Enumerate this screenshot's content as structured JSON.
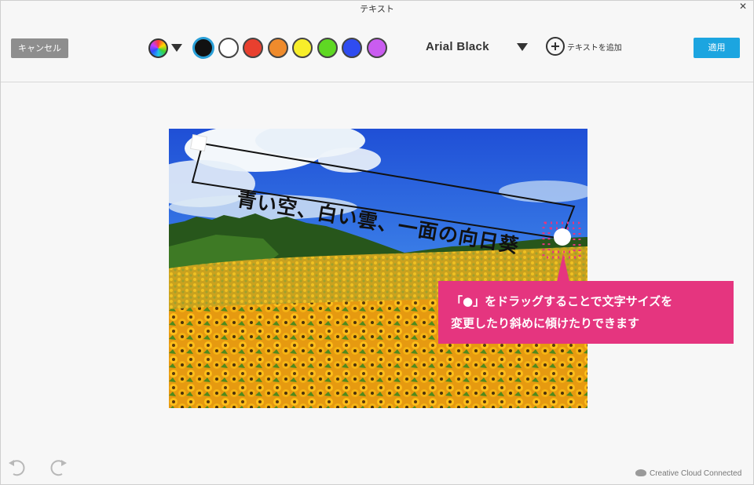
{
  "window": {
    "title": "テキスト"
  },
  "toolbar": {
    "cancel_label": "キャンセル",
    "apply_label": "適用",
    "font_name": "Arial Black",
    "add_text_label": "テキストを追加",
    "swatches": [
      {
        "name": "black",
        "color": "#111111",
        "selected": true
      },
      {
        "name": "white",
        "color": "#ffffff",
        "selected": false
      },
      {
        "name": "red",
        "color": "#e8402f",
        "selected": false
      },
      {
        "name": "orange",
        "color": "#ef8b2c",
        "selected": false
      },
      {
        "name": "yellow",
        "color": "#f7ee2a",
        "selected": false
      },
      {
        "name": "green",
        "color": "#5fd823",
        "selected": false
      },
      {
        "name": "blue",
        "color": "#2f4cf0",
        "selected": false
      },
      {
        "name": "purple",
        "color": "#c95cf0",
        "selected": false
      }
    ]
  },
  "canvas": {
    "overlay_text": "青い空、白い雲、一面の向日葵",
    "callout_line1": "「●」をドラッグすることで文字サイズを",
    "callout_line2": "変更したり斜めに傾けたりできます"
  },
  "footer": {
    "status": "Creative Cloud Connected",
    "undo_icon": "undo-icon",
    "redo_icon": "redo-icon"
  },
  "colors": {
    "accent_blue": "#1ca5e0",
    "callout_pink": "#e5357f",
    "cancel_gray": "#8e8e8e"
  }
}
